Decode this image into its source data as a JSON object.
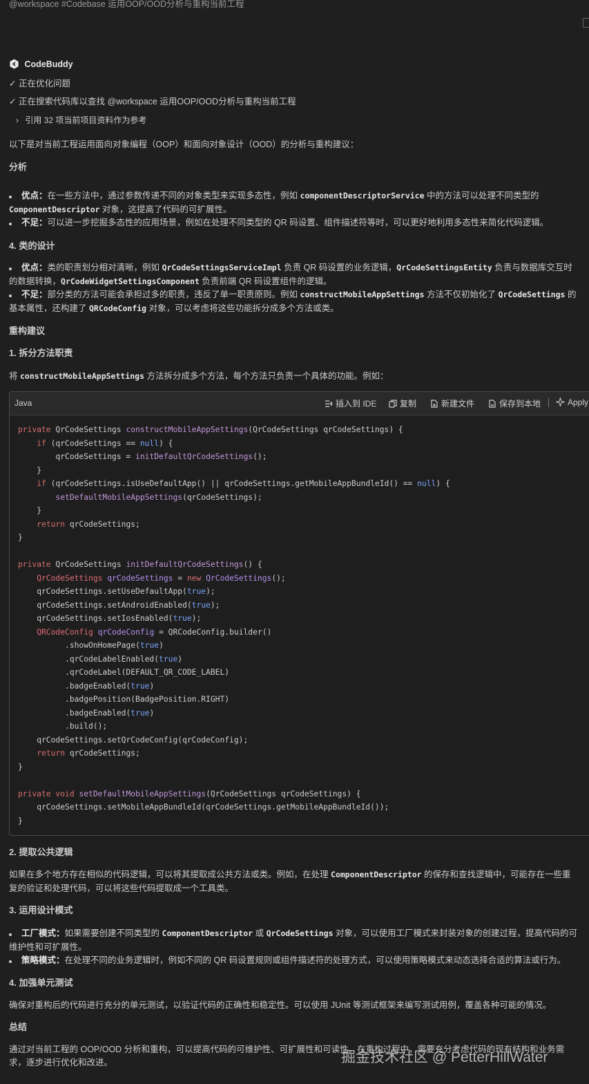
{
  "prompt": {
    "text": "@workspace #Codebase 运用OOP/OOD分析与重构当前工程"
  },
  "assistant": {
    "name": "CodeBuddy",
    "steps": [
      "正在优化问题",
      "正在搜索代码库以查找 @workspace 运用OOP/OOD分析与重构当前工程"
    ],
    "references": "引用 32 项当前项目资料作为参考"
  },
  "intro": "以下是对当前工程运用面向对象编程（OOP）和面向对象设计（OOD）的分析与重构建议：",
  "analysis": {
    "heading": "分析",
    "pros_label": "优点：",
    "pros_text_1": "在一些方法中，通过参数传递不同的对象类型来实现多态性，例如",
    "pros_code_1": "componentDescriptorService",
    "pros_text_2": "中的方法可以处理不同类型的",
    "pros_code_2": "ComponentDescriptor",
    "pros_text_3": "对象，这提高了代码的可扩展性。",
    "cons_label": "不足：",
    "cons_text": "可以进一步挖掘多态性的应用场景，例如在处理不同类型的 QR 码设置、组件描述符等时，可以更好地利用多态性来简化代码逻辑。"
  },
  "class_design": {
    "heading": "4. 类的设计",
    "pros_label": "优点：",
    "pros_text_1": "类的职责划分相对清晰，例如",
    "pros_code_1": "QrCodeSettingsServiceImpl",
    "pros_text_2": "负责 QR 码设置的业务逻辑，",
    "pros_code_2": "QrCodeSettingsEntity",
    "pros_text_3": "负责与数据库交互时",
    "pros_line2_text_1": "的数据转换，",
    "pros_code_3": "QrCodeWidgetSettingsComponent",
    "pros_line2_text_2": "负责前端 QR 码设置组件的逻辑。",
    "cons_label": "不足：",
    "cons_text_1": "部分类的方法可能会承担过多的职责，违反了单一职责原则。例如",
    "cons_code_1": "constructMobileAppSettings",
    "cons_text_2": "方法不仅初始化了",
    "cons_code_2": "QrCodeSettings",
    "cons_text_3": "的",
    "cons_line2_text_1": "基本属性，还构建了",
    "cons_code_3": "QRCodeConfig",
    "cons_line2_text_2": "对象，可以考虑将这些功能拆分成多个方法或类。"
  },
  "refactor": {
    "heading": "重构建议",
    "split": {
      "heading": "1. 拆分方法职责",
      "text_1": "将",
      "code": "constructMobileAppSettings",
      "text_2": "方法拆分成多个方法，每个方法只负责一个具体的功能。例如："
    }
  },
  "code_block": {
    "language": "Java",
    "actions": [
      "插入到 IDE",
      "复制",
      "新建文件",
      "保存到本地",
      "Apply"
    ],
    "lines": [
      "private QrCodeSettings constructMobileAppSettings(QrCodeSettings qrCodeSettings) {",
      "    if (qrCodeSettings == null) {",
      "        qrCodeSettings = initDefaultQrCodeSettings();",
      "    }",
      "    if (qrCodeSettings.isUseDefaultApp() || qrCodeSettings.getMobileAppBundleId() == null) {",
      "        setDefaultMobileAppSettings(qrCodeSettings);",
      "    }",
      "    return qrCodeSettings;",
      "}",
      "",
      "private QrCodeSettings initDefaultQrCodeSettings() {",
      "    QrCodeSettings qrCodeSettings = new QrCodeSettings();",
      "    qrCodeSettings.setUseDefaultApp(true);",
      "    qrCodeSettings.setAndroidEnabled(true);",
      "    qrCodeSettings.setIosEnabled(true);",
      "    QRCodeConfig qrCodeConfig = QRCodeConfig.builder()",
      "          .showOnHomePage(true)",
      "          .qrCodeLabelEnabled(true)",
      "          .qrCodeLabel(DEFAULT_QR_CODE_LABEL)",
      "          .badgeEnabled(true)",
      "          .badgePosition(BadgePosition.RIGHT)",
      "          .badgeEnabled(true)",
      "          .build();",
      "    qrCodeSettings.setQrCodeConfig(qrCodeConfig);",
      "    return qrCodeSettings;",
      "}",
      "",
      "private void setDefaultMobileAppSettings(QrCodeSettings qrCodeSettings) {",
      "    qrCodeSettings.setMobileAppBundleId(qrCodeSettings.getMobileAppBundleId());",
      "}"
    ]
  },
  "extract": {
    "heading": "2. 提取公共逻辑",
    "text_1": "如果在多个地方存在相似的代码逻辑，可以将其提取成公共方法或类。例如，在处理",
    "code": "ComponentDescriptor",
    "text_2": "的保存和查找逻辑中，可能存在一些重",
    "line2": "复的验证和处理代码，可以将这些代码提取成一个工具类。"
  },
  "patterns": {
    "heading": "3. 运用设计模式",
    "factory_label": "工厂模式：",
    "factory_text_1": "如果需要创建不同类型的",
    "factory_code_1": "ComponentDescriptor",
    "factory_text_2": "或",
    "factory_code_2": "QrCodeSettings",
    "factory_text_3": "对象，可以使用工厂模式来封装对象的创建过程，提高代码的可",
    "factory_line2": "维护性和可扩展性。",
    "strategy_label": "策略模式：",
    "strategy_text": "在处理不同的业务逻辑时，例如不同的 QR 码设置规则或组件描述符的处理方式，可以使用策略模式来动态选择合适的算法或行为。"
  },
  "testing": {
    "heading": "4. 加强单元测试",
    "text": "确保对重构后的代码进行充分的单元测试，以验证代码的正确性和稳定性。可以使用 JUnit 等测试框架来编写测试用例，覆盖各种可能的情况。"
  },
  "summary": {
    "heading": "总结",
    "line1": "通过对当前工程的 OOP/OOD 分析和重构，可以提高代码的可维护性、可扩展性和可读性。在重构过程中，需要充分考虑代码的现有结构和业务需",
    "line2": "求，逐步进行优化和改进。"
  },
  "watermark": "掘金技术社区 @ PetterHillWater"
}
